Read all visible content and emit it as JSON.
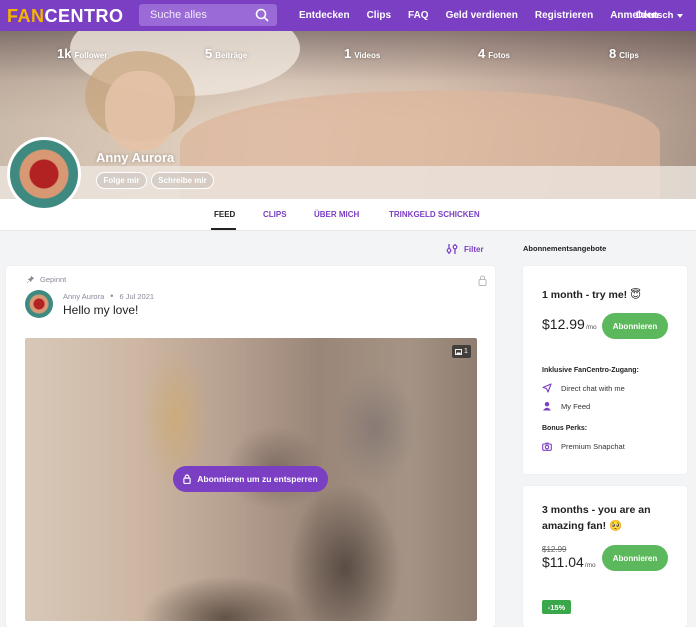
{
  "nav": {
    "logo_part1": "FAN",
    "logo_part2": "CENTRO",
    "search_placeholder": "Suche alles",
    "links": [
      "Entdecken",
      "Clips",
      "FAQ",
      "Geld verdienen",
      "Registrieren",
      "Anmelden"
    ],
    "language": "Deutsch"
  },
  "profile": {
    "name": "Anny Aurora",
    "stats": [
      {
        "num": "1k",
        "label": "Follower"
      },
      {
        "num": "5",
        "label": "Beiträge"
      },
      {
        "num": "1",
        "label": "Videos"
      },
      {
        "num": "4",
        "label": "Fotos"
      },
      {
        "num": "8",
        "label": "Clips"
      }
    ],
    "follow_label": "Folge mir",
    "message_label": "Schreibe mir"
  },
  "tabs": [
    "FEED",
    "CLIPS",
    "ÜBER MICH",
    "TRINKGELD SCHICKEN"
  ],
  "filter_label": "Filter",
  "post": {
    "pinned_label": "Gepinnt",
    "author": "Anny Aurora",
    "date": "6 Jul 2021",
    "text": "Hello my love!",
    "media_count": "1",
    "unlock_label": "Abonnieren um zu entsperren"
  },
  "subscriptions": {
    "heading": "Abonnementsangebote",
    "plans": [
      {
        "title": "1 month - try me! 😇",
        "price": "$12.99",
        "per": "/mo",
        "button": "Abonnieren",
        "includes_label": "Inklusive FanCentro-Zugang:",
        "features": [
          "Direct chat with me",
          "My Feed"
        ],
        "bonus_label": "Bonus Perks:",
        "bonus": [
          "Premium Snapchat"
        ]
      },
      {
        "title_line1": "3 months - you are an",
        "title_line2": "amazing fan! 🥺",
        "old_price": "$12.99",
        "price": "$11.04",
        "per": "/mo",
        "button": "Abonnieren",
        "discount": "-15%"
      }
    ]
  },
  "colors": {
    "brand": "#7b3fc4",
    "accent": "#f4b400",
    "cta": "#5cb85c",
    "discount": "#39a74a"
  }
}
